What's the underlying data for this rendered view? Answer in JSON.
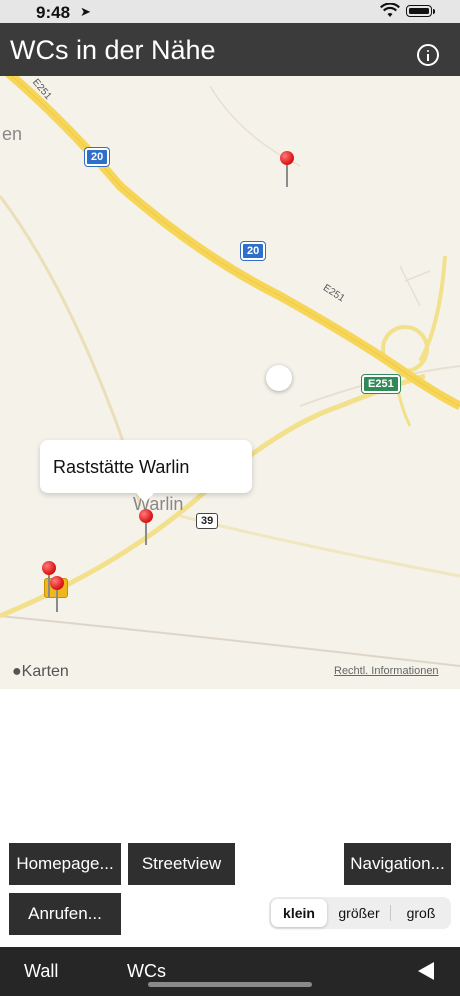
{
  "status": {
    "time": "9:48"
  },
  "header": {
    "title": "WCs in der Nähe"
  },
  "map": {
    "place_partial_left": "en",
    "shields": {
      "a20_top": "20",
      "a20_mid": "20",
      "e251_green": "E251",
      "road39": "39"
    },
    "road_labels": {
      "e251_top": "E251",
      "e251_mid": "E251"
    },
    "town": "Warlin",
    "callout": "Raststätte Warlin",
    "attribution": "Karten",
    "legal": "Rechtl. Informationen"
  },
  "buttons": {
    "homepage": "Homepage...",
    "streetview": "Streetview",
    "navigation": "Navigation...",
    "call": "Anrufen..."
  },
  "size_selector": {
    "options": [
      "klein",
      "größer",
      "groß"
    ],
    "selected": "klein"
  },
  "tabbar": {
    "wall": "Wall",
    "wcs": "WCs"
  }
}
